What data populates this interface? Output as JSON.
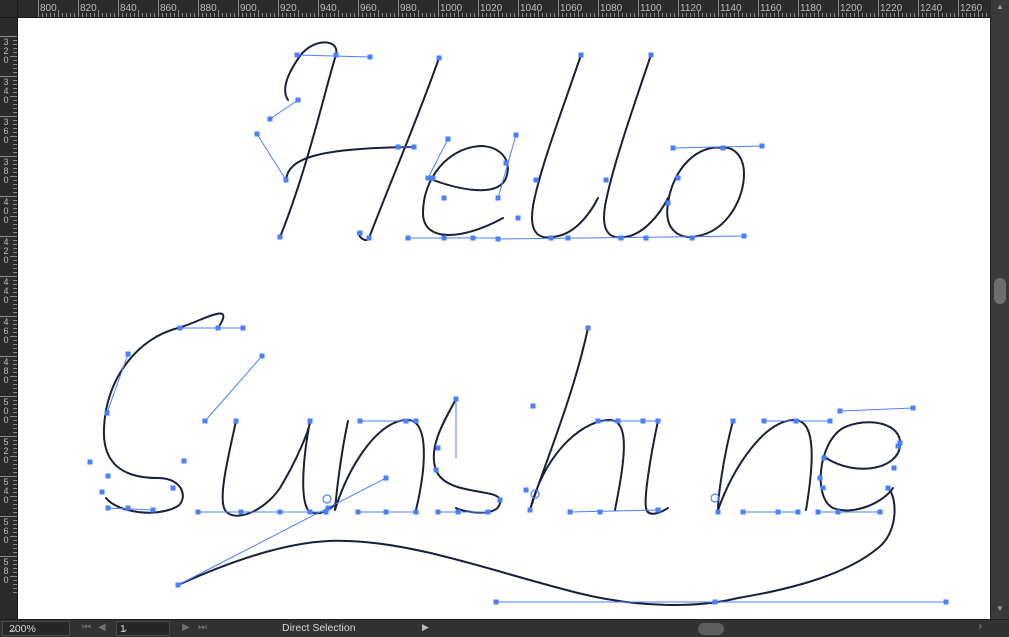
{
  "rulers": {
    "top_labels": [
      "800",
      "820",
      "840",
      "860",
      "880",
      "900",
      "920",
      "940",
      "960",
      "980",
      "1000",
      "1020",
      "1040",
      "1060",
      "1080",
      "1100",
      "1120",
      "1140",
      "1160",
      "1180",
      "1200",
      "1220",
      "1240",
      "1260"
    ],
    "left_labels": [
      "320",
      "340",
      "360",
      "380",
      "400",
      "420",
      "440",
      "460",
      "480",
      "500",
      "520",
      "540",
      "560",
      "580"
    ]
  },
  "artwork": {
    "text_lines": [
      "Hello",
      "Sunshine"
    ],
    "path_color": "#1a1f3a",
    "handle_color": "#4a7fff"
  },
  "statusbar": {
    "zoom": "200%",
    "artboard_number": "1",
    "current_tool": "Direct Selection"
  },
  "icons": {
    "dropdown": "chevron-down-icon",
    "first": "first-artboard-icon",
    "prev": "previous-artboard-icon",
    "next": "next-artboard-icon",
    "last": "last-artboard-icon",
    "play": "play-icon"
  }
}
